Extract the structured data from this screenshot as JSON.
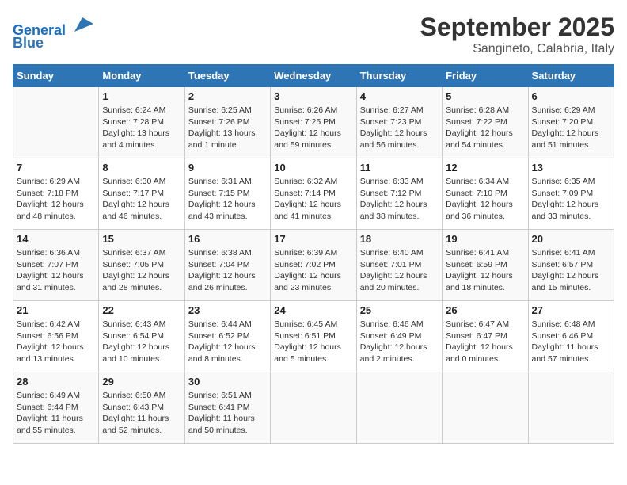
{
  "header": {
    "logo_line1": "General",
    "logo_line2": "Blue",
    "title": "September 2025",
    "subtitle": "Sangineto, Calabria, Italy"
  },
  "days_of_week": [
    "Sunday",
    "Monday",
    "Tuesday",
    "Wednesday",
    "Thursday",
    "Friday",
    "Saturday"
  ],
  "weeks": [
    [
      {
        "day": "",
        "info": ""
      },
      {
        "day": "1",
        "info": "Sunrise: 6:24 AM\nSunset: 7:28 PM\nDaylight: 13 hours\nand 4 minutes."
      },
      {
        "day": "2",
        "info": "Sunrise: 6:25 AM\nSunset: 7:26 PM\nDaylight: 13 hours\nand 1 minute."
      },
      {
        "day": "3",
        "info": "Sunrise: 6:26 AM\nSunset: 7:25 PM\nDaylight: 12 hours\nand 59 minutes."
      },
      {
        "day": "4",
        "info": "Sunrise: 6:27 AM\nSunset: 7:23 PM\nDaylight: 12 hours\nand 56 minutes."
      },
      {
        "day": "5",
        "info": "Sunrise: 6:28 AM\nSunset: 7:22 PM\nDaylight: 12 hours\nand 54 minutes."
      },
      {
        "day": "6",
        "info": "Sunrise: 6:29 AM\nSunset: 7:20 PM\nDaylight: 12 hours\nand 51 minutes."
      }
    ],
    [
      {
        "day": "7",
        "info": "Sunrise: 6:29 AM\nSunset: 7:18 PM\nDaylight: 12 hours\nand 48 minutes."
      },
      {
        "day": "8",
        "info": "Sunrise: 6:30 AM\nSunset: 7:17 PM\nDaylight: 12 hours\nand 46 minutes."
      },
      {
        "day": "9",
        "info": "Sunrise: 6:31 AM\nSunset: 7:15 PM\nDaylight: 12 hours\nand 43 minutes."
      },
      {
        "day": "10",
        "info": "Sunrise: 6:32 AM\nSunset: 7:14 PM\nDaylight: 12 hours\nand 41 minutes."
      },
      {
        "day": "11",
        "info": "Sunrise: 6:33 AM\nSunset: 7:12 PM\nDaylight: 12 hours\nand 38 minutes."
      },
      {
        "day": "12",
        "info": "Sunrise: 6:34 AM\nSunset: 7:10 PM\nDaylight: 12 hours\nand 36 minutes."
      },
      {
        "day": "13",
        "info": "Sunrise: 6:35 AM\nSunset: 7:09 PM\nDaylight: 12 hours\nand 33 minutes."
      }
    ],
    [
      {
        "day": "14",
        "info": "Sunrise: 6:36 AM\nSunset: 7:07 PM\nDaylight: 12 hours\nand 31 minutes."
      },
      {
        "day": "15",
        "info": "Sunrise: 6:37 AM\nSunset: 7:05 PM\nDaylight: 12 hours\nand 28 minutes."
      },
      {
        "day": "16",
        "info": "Sunrise: 6:38 AM\nSunset: 7:04 PM\nDaylight: 12 hours\nand 26 minutes."
      },
      {
        "day": "17",
        "info": "Sunrise: 6:39 AM\nSunset: 7:02 PM\nDaylight: 12 hours\nand 23 minutes."
      },
      {
        "day": "18",
        "info": "Sunrise: 6:40 AM\nSunset: 7:01 PM\nDaylight: 12 hours\nand 20 minutes."
      },
      {
        "day": "19",
        "info": "Sunrise: 6:41 AM\nSunset: 6:59 PM\nDaylight: 12 hours\nand 18 minutes."
      },
      {
        "day": "20",
        "info": "Sunrise: 6:41 AM\nSunset: 6:57 PM\nDaylight: 12 hours\nand 15 minutes."
      }
    ],
    [
      {
        "day": "21",
        "info": "Sunrise: 6:42 AM\nSunset: 6:56 PM\nDaylight: 12 hours\nand 13 minutes."
      },
      {
        "day": "22",
        "info": "Sunrise: 6:43 AM\nSunset: 6:54 PM\nDaylight: 12 hours\nand 10 minutes."
      },
      {
        "day": "23",
        "info": "Sunrise: 6:44 AM\nSunset: 6:52 PM\nDaylight: 12 hours\nand 8 minutes."
      },
      {
        "day": "24",
        "info": "Sunrise: 6:45 AM\nSunset: 6:51 PM\nDaylight: 12 hours\nand 5 minutes."
      },
      {
        "day": "25",
        "info": "Sunrise: 6:46 AM\nSunset: 6:49 PM\nDaylight: 12 hours\nand 2 minutes."
      },
      {
        "day": "26",
        "info": "Sunrise: 6:47 AM\nSunset: 6:47 PM\nDaylight: 12 hours\nand 0 minutes."
      },
      {
        "day": "27",
        "info": "Sunrise: 6:48 AM\nSunset: 6:46 PM\nDaylight: 11 hours\nand 57 minutes."
      }
    ],
    [
      {
        "day": "28",
        "info": "Sunrise: 6:49 AM\nSunset: 6:44 PM\nDaylight: 11 hours\nand 55 minutes."
      },
      {
        "day": "29",
        "info": "Sunrise: 6:50 AM\nSunset: 6:43 PM\nDaylight: 11 hours\nand 52 minutes."
      },
      {
        "day": "30",
        "info": "Sunrise: 6:51 AM\nSunset: 6:41 PM\nDaylight: 11 hours\nand 50 minutes."
      },
      {
        "day": "",
        "info": ""
      },
      {
        "day": "",
        "info": ""
      },
      {
        "day": "",
        "info": ""
      },
      {
        "day": "",
        "info": ""
      }
    ]
  ]
}
